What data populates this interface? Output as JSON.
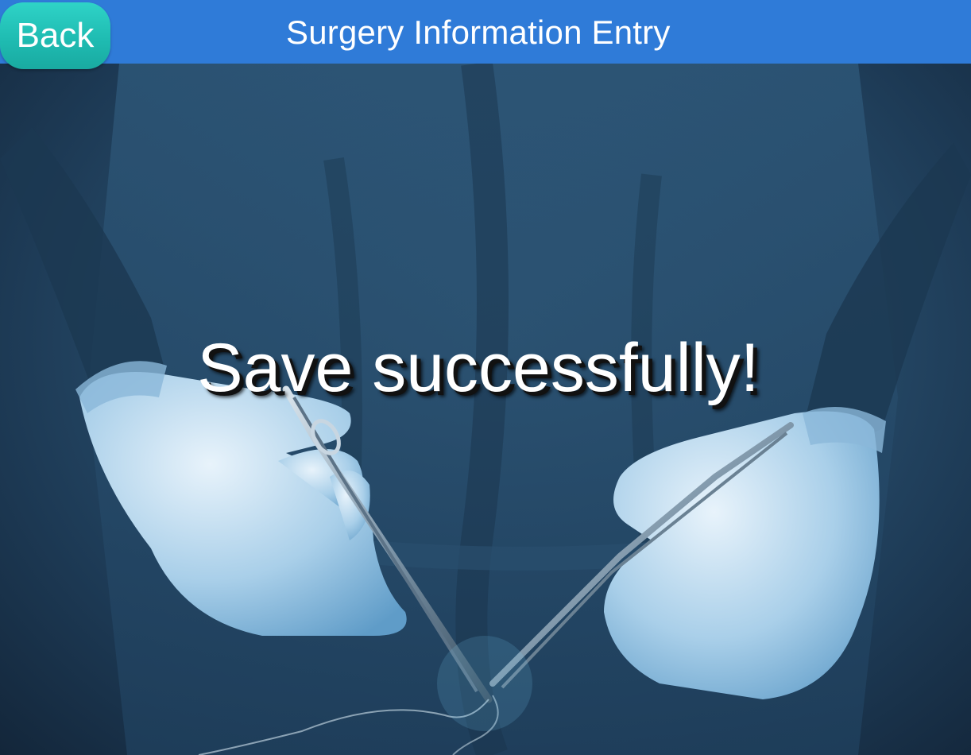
{
  "header": {
    "title": "Surgery Information Entry",
    "back_label": "Back"
  },
  "main": {
    "message": "Save successfully!"
  },
  "colors": {
    "header_bar": "#2f7bd8",
    "back_button": "#1fbcb2",
    "text": "#ffffff"
  }
}
